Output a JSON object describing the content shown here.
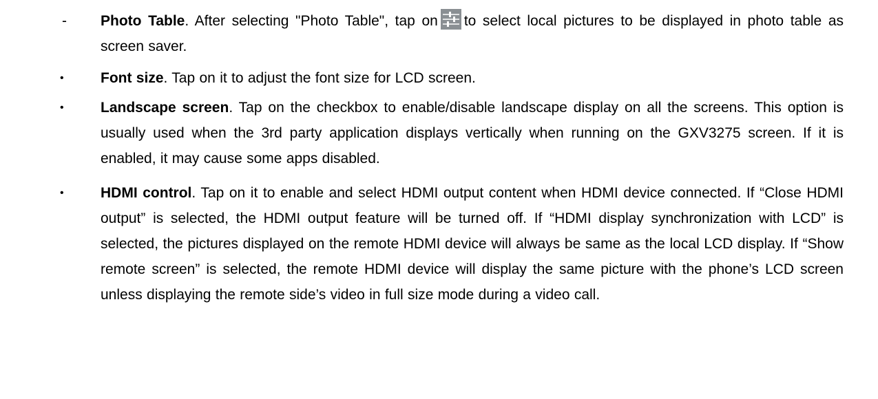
{
  "items": [
    {
      "marker": "-",
      "term": "Photo Table",
      "before_icon": ". After selecting \"Photo Table\", tap on",
      "icon": "settings-sliders-icon",
      "after_icon": "to select local pictures to be displayed in photo table as screen saver."
    },
    {
      "marker": "•",
      "term": "Font size",
      "text": ". Tap on it to adjust the font size for LCD screen."
    },
    {
      "marker": "•",
      "term": "Landscape screen",
      "text": ". Tap on the checkbox to enable/disable landscape display on all the screens. This option is usually used when the 3rd party application displays vertically when running on the GXV3275 screen. If it is enabled, it may cause some apps disabled."
    },
    {
      "marker": "•",
      "term": "HDMI control",
      "text": ". Tap on it to enable and select HDMI output content when HDMI device connected. If “Close HDMI output” is selected, the HDMI output feature will be turned off. If “HDMI display synchronization with LCD” is selected, the pictures displayed on the remote HDMI device will always be same as the local LCD display. If “Show remote screen” is selected, the remote HDMI device will display the same picture with the phone’s LCD screen unless displaying the remote side’s video in full size mode during a video call."
    }
  ],
  "colors": {
    "text": "#000000",
    "icon_bg": "#8a8f93",
    "icon_fg": "#ffffff"
  }
}
